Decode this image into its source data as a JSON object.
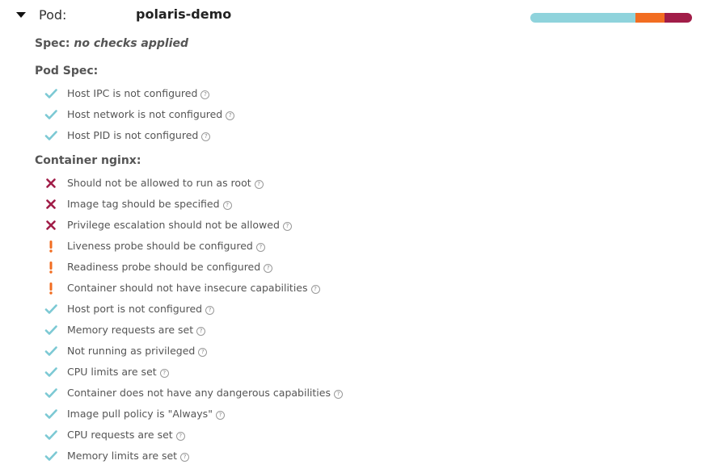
{
  "pod": {
    "label": "Pod:",
    "name": "polaris-demo",
    "score": {
      "success": 0.65,
      "warning": 0.18,
      "danger": 0.17
    },
    "colors": {
      "success": "#8fd3dc",
      "warning": "#f26d21",
      "danger": "#a11d48"
    }
  },
  "spec": {
    "label": "Spec:",
    "value": "no checks applied"
  },
  "pod_spec": {
    "title": "Pod Spec:",
    "checks": [
      {
        "message": "Host IPC is not configured",
        "status": "success",
        "icon": "check-icon"
      },
      {
        "message": "Host network is not configured",
        "status": "success",
        "icon": "check-icon"
      },
      {
        "message": "Host PID is not configured",
        "status": "success",
        "icon": "check-icon"
      }
    ]
  },
  "container": {
    "title": "Container nginx:",
    "checks": [
      {
        "message": "Should not be allowed to run as root",
        "status": "danger",
        "icon": "x-icon"
      },
      {
        "message": "Image tag should be specified",
        "status": "danger",
        "icon": "x-icon"
      },
      {
        "message": "Privilege escalation should not be allowed",
        "status": "danger",
        "icon": "x-icon"
      },
      {
        "message": "Liveness probe should be configured",
        "status": "warning",
        "icon": "exclamation-icon"
      },
      {
        "message": "Readiness probe should be configured",
        "status": "warning",
        "icon": "exclamation-icon"
      },
      {
        "message": "Container should not have insecure capabilities",
        "status": "warning",
        "icon": "exclamation-icon"
      },
      {
        "message": "Host port is not configured",
        "status": "success",
        "icon": "check-icon"
      },
      {
        "message": "Memory requests are set",
        "status": "success",
        "icon": "check-icon"
      },
      {
        "message": "Not running as privileged",
        "status": "success",
        "icon": "check-icon"
      },
      {
        "message": "CPU limits are set",
        "status": "success",
        "icon": "check-icon"
      },
      {
        "message": "Container does not have any dangerous capabilities",
        "status": "success",
        "icon": "check-icon"
      },
      {
        "message": "Image pull policy is \"Always\"",
        "status": "success",
        "icon": "check-icon"
      },
      {
        "message": "CPU requests are set",
        "status": "success",
        "icon": "check-icon"
      },
      {
        "message": "Memory limits are set",
        "status": "success",
        "icon": "check-icon"
      }
    ]
  },
  "help_glyph": "?"
}
